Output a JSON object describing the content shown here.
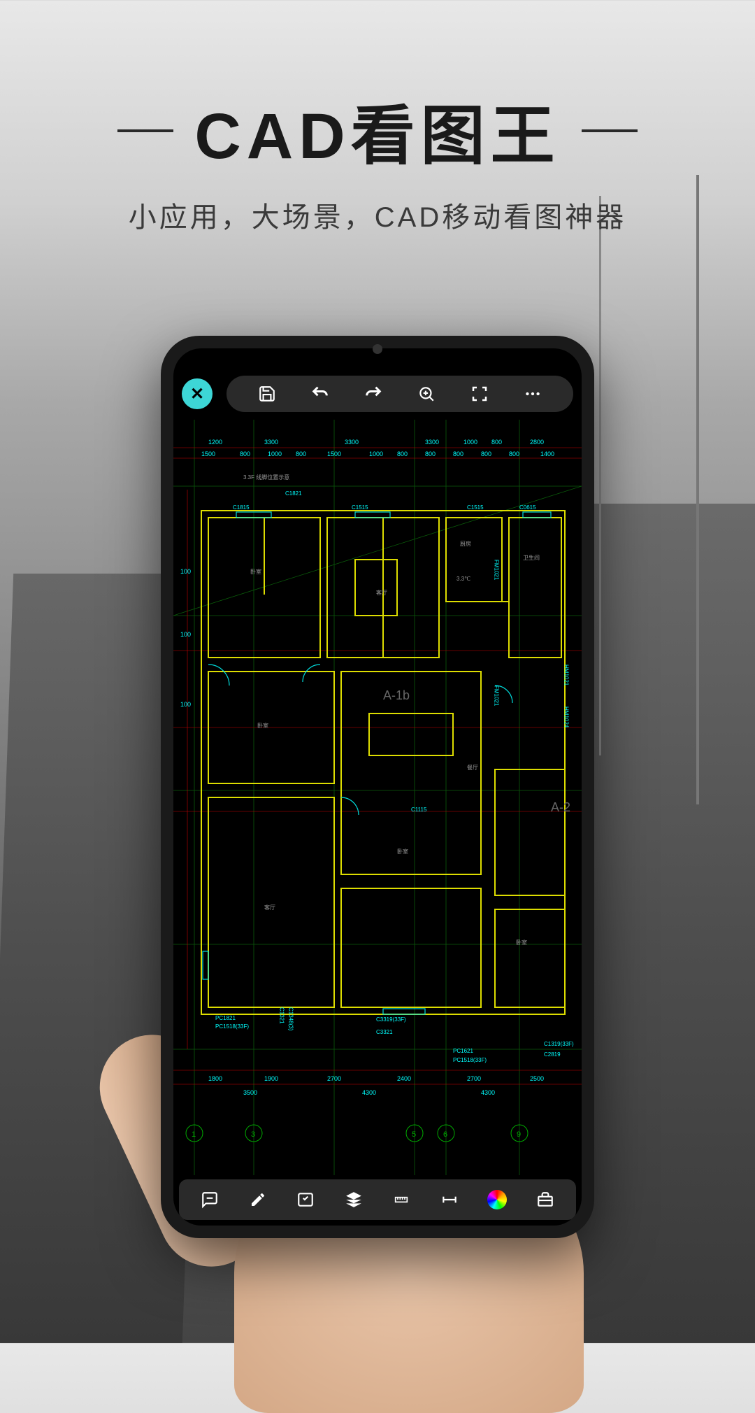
{
  "header": {
    "title": "CAD看图王",
    "subtitle": "小应用，大场景，CAD移动看图神器"
  },
  "toolbar_top": {
    "close": "✕",
    "icons": [
      "save",
      "undo",
      "redo",
      "zoom-target",
      "fullscreen",
      "more"
    ]
  },
  "toolbar_bottom": {
    "icons": [
      "comment",
      "pencil",
      "edit",
      "layers",
      "ruler",
      "dimension",
      "color-picker",
      "toolbox"
    ]
  },
  "cad": {
    "unit_label": "A-1b",
    "unit_label_2": "A-2",
    "annotation": "3.3F 线脚位置示意",
    "dimensions_top": [
      "1200",
      "3300",
      "3300",
      "3300",
      "1000",
      "800",
      "2800"
    ],
    "dimensions_top2": [
      "1500",
      "800",
      "1000",
      "800",
      "1500",
      "1000",
      "800",
      "800",
      "800",
      "800",
      "800",
      "1400"
    ],
    "dimensions_bottom": [
      "1800",
      "1900",
      "2700",
      "2400",
      "2700",
      "2500"
    ],
    "dimensions_bottom2": [
      "3500",
      "4300",
      "4300"
    ],
    "dimensions_left": [
      "100",
      "100",
      "100"
    ],
    "window_labels": [
      "C1815",
      "C1515",
      "C1821",
      "C0615",
      "C1515",
      "C1115",
      "C3319(33F)",
      "C3321",
      "C2819",
      "C1319(33F)"
    ],
    "door_labels": [
      "PC1821",
      "PC1518(33F)",
      "PC1621",
      "PC1518(33F)",
      "FM1021",
      "HM1021",
      "FM1021",
      "HM1024"
    ],
    "room_labels": [
      "卧室",
      "客厅",
      "厨房",
      "卫生间",
      "卧室",
      "餐厅",
      "卧室",
      "客厅",
      "卧室"
    ],
    "temp_label": "3.3℃",
    "axis_labels": [
      "1",
      "3",
      "5",
      "6",
      "9"
    ],
    "c_labels": [
      "C1321",
      "C1348(3)"
    ]
  }
}
